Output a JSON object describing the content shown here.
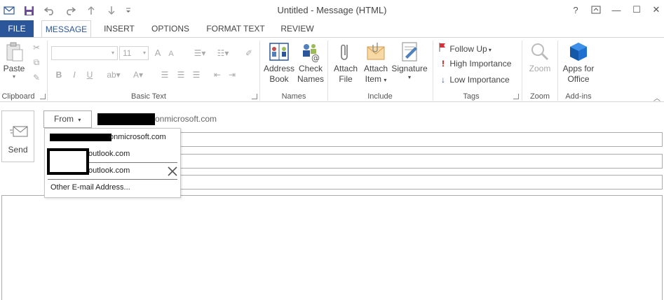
{
  "window": {
    "title": "Untitled - Message (HTML)",
    "help": "?",
    "restore_icon": "ribbon-display-icon",
    "minimize": "—",
    "maximize": "☐",
    "close": "✕"
  },
  "quick_access": {
    "icons": [
      "mail-icon",
      "save-icon",
      "undo-icon",
      "redo-icon",
      "up-arrow-icon",
      "down-arrow-icon",
      "customize-icon"
    ]
  },
  "tabs": [
    {
      "label": "FILE"
    },
    {
      "label": "MESSAGE"
    },
    {
      "label": "INSERT"
    },
    {
      "label": "OPTIONS"
    },
    {
      "label": "FORMAT TEXT"
    },
    {
      "label": "REVIEW"
    }
  ],
  "ribbon": {
    "clipboard": {
      "label": "Clipboard",
      "paste": "Paste"
    },
    "basic_text": {
      "label": "Basic Text",
      "font_size": "11",
      "bold": "B",
      "italic": "I",
      "underline": "U",
      "grow": "A",
      "shrink": "A"
    },
    "names": {
      "label": "Names",
      "address_book": [
        "Address",
        "Book"
      ],
      "check_names": [
        "Check",
        "Names"
      ]
    },
    "include": {
      "label": "Include",
      "attach_file": [
        "Attach",
        "File"
      ],
      "attach_item": [
        "Attach",
        "Item"
      ],
      "signature": "Signature"
    },
    "tags": {
      "label": "Tags",
      "follow_up": "Follow Up",
      "high_importance": "High Importance",
      "low_importance": "Low Importance"
    },
    "zoom": {
      "label": "Zoom",
      "zoom": "Zoom"
    },
    "addins": {
      "label": "Add-ins",
      "apps": [
        "Apps for",
        "Office"
      ]
    }
  },
  "compose": {
    "send_label": "Send",
    "from_button": "From",
    "from_address_suffix": "onmicrosoft.com"
  },
  "from_dropdown": {
    "items": [
      {
        "suffix": "onmicrosoft.com"
      },
      {
        "suffix": "outlook.com"
      },
      {
        "suffix": "outlook.com"
      }
    ],
    "other": "Other E-mail Address..."
  },
  "colors": {
    "file_tab": "#2b579a",
    "accent": "#2b579a",
    "follow_up_flag": "#d13438",
    "high_importance": "#c00000",
    "low_importance": "#2b579a"
  }
}
